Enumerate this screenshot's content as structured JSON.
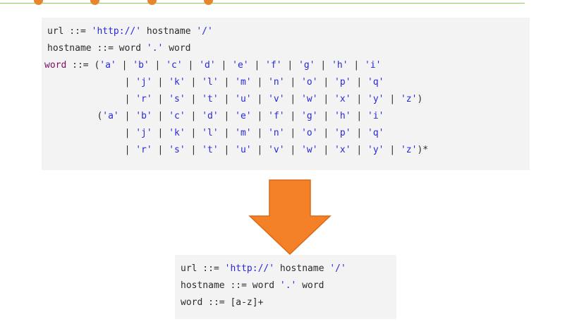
{
  "decor": {
    "line_color": "#8fd14f",
    "dot_color": "#e8862c",
    "dot_count": 4
  },
  "top_code": {
    "lines": [
      [
        {
          "t": "txt",
          "v": "url ::= "
        },
        {
          "t": "str",
          "v": "'http://'"
        },
        {
          "t": "txt",
          "v": " hostname "
        },
        {
          "t": "str",
          "v": "'/'"
        }
      ],
      [
        {
          "t": "txt",
          "v": "hostname ::= word "
        },
        {
          "t": "str",
          "v": "'.'"
        },
        {
          "t": "txt",
          "v": " word"
        }
      ],
      [
        {
          "t": "kw-def",
          "v": "word"
        },
        {
          "t": "txt",
          "v": " ::= ("
        },
        {
          "t": "str",
          "v": "'a'"
        },
        {
          "t": "txt",
          "v": " | "
        },
        {
          "t": "str",
          "v": "'b'"
        },
        {
          "t": "txt",
          "v": " | "
        },
        {
          "t": "str",
          "v": "'c'"
        },
        {
          "t": "txt",
          "v": " | "
        },
        {
          "t": "str",
          "v": "'d'"
        },
        {
          "t": "txt",
          "v": " | "
        },
        {
          "t": "str",
          "v": "'e'"
        },
        {
          "t": "txt",
          "v": " | "
        },
        {
          "t": "str",
          "v": "'f'"
        },
        {
          "t": "txt",
          "v": " | "
        },
        {
          "t": "str",
          "v": "'g'"
        },
        {
          "t": "txt",
          "v": " | "
        },
        {
          "t": "str",
          "v": "'h'"
        },
        {
          "t": "txt",
          "v": " | "
        },
        {
          "t": "str",
          "v": "'i'"
        }
      ],
      [
        {
          "t": "txt",
          "v": "              | "
        },
        {
          "t": "str",
          "v": "'j'"
        },
        {
          "t": "txt",
          "v": " | "
        },
        {
          "t": "str",
          "v": "'k'"
        },
        {
          "t": "txt",
          "v": " | "
        },
        {
          "t": "str",
          "v": "'l'"
        },
        {
          "t": "txt",
          "v": " | "
        },
        {
          "t": "str",
          "v": "'m'"
        },
        {
          "t": "txt",
          "v": " | "
        },
        {
          "t": "str",
          "v": "'n'"
        },
        {
          "t": "txt",
          "v": " | "
        },
        {
          "t": "str",
          "v": "'o'"
        },
        {
          "t": "txt",
          "v": " | "
        },
        {
          "t": "str",
          "v": "'p'"
        },
        {
          "t": "txt",
          "v": " | "
        },
        {
          "t": "str",
          "v": "'q'"
        }
      ],
      [
        {
          "t": "txt",
          "v": "              | "
        },
        {
          "t": "str",
          "v": "'r'"
        },
        {
          "t": "txt",
          "v": " | "
        },
        {
          "t": "str",
          "v": "'s'"
        },
        {
          "t": "txt",
          "v": " | "
        },
        {
          "t": "str",
          "v": "'t'"
        },
        {
          "t": "txt",
          "v": " | "
        },
        {
          "t": "str",
          "v": "'u'"
        },
        {
          "t": "txt",
          "v": " | "
        },
        {
          "t": "str",
          "v": "'v'"
        },
        {
          "t": "txt",
          "v": " | "
        },
        {
          "t": "str",
          "v": "'w'"
        },
        {
          "t": "txt",
          "v": " | "
        },
        {
          "t": "str",
          "v": "'x'"
        },
        {
          "t": "txt",
          "v": " | "
        },
        {
          "t": "str",
          "v": "'y'"
        },
        {
          "t": "txt",
          "v": " | "
        },
        {
          "t": "str",
          "v": "'z'"
        },
        {
          "t": "txt",
          "v": ")"
        }
      ],
      [
        {
          "t": "txt",
          "v": "         ("
        },
        {
          "t": "str",
          "v": "'a'"
        },
        {
          "t": "txt",
          "v": " | "
        },
        {
          "t": "str",
          "v": "'b'"
        },
        {
          "t": "txt",
          "v": " | "
        },
        {
          "t": "str",
          "v": "'c'"
        },
        {
          "t": "txt",
          "v": " | "
        },
        {
          "t": "str",
          "v": "'d'"
        },
        {
          "t": "txt",
          "v": " | "
        },
        {
          "t": "str",
          "v": "'e'"
        },
        {
          "t": "txt",
          "v": " | "
        },
        {
          "t": "str",
          "v": "'f'"
        },
        {
          "t": "txt",
          "v": " | "
        },
        {
          "t": "str",
          "v": "'g'"
        },
        {
          "t": "txt",
          "v": " | "
        },
        {
          "t": "str",
          "v": "'h'"
        },
        {
          "t": "txt",
          "v": " | "
        },
        {
          "t": "str",
          "v": "'i'"
        }
      ],
      [
        {
          "t": "txt",
          "v": "              | "
        },
        {
          "t": "str",
          "v": "'j'"
        },
        {
          "t": "txt",
          "v": " | "
        },
        {
          "t": "str",
          "v": "'k'"
        },
        {
          "t": "txt",
          "v": " | "
        },
        {
          "t": "str",
          "v": "'l'"
        },
        {
          "t": "txt",
          "v": " | "
        },
        {
          "t": "str",
          "v": "'m'"
        },
        {
          "t": "txt",
          "v": " | "
        },
        {
          "t": "str",
          "v": "'n'"
        },
        {
          "t": "txt",
          "v": " | "
        },
        {
          "t": "str",
          "v": "'o'"
        },
        {
          "t": "txt",
          "v": " | "
        },
        {
          "t": "str",
          "v": "'p'"
        },
        {
          "t": "txt",
          "v": " | "
        },
        {
          "t": "str",
          "v": "'q'"
        }
      ],
      [
        {
          "t": "txt",
          "v": "              | "
        },
        {
          "t": "str",
          "v": "'r'"
        },
        {
          "t": "txt",
          "v": " | "
        },
        {
          "t": "str",
          "v": "'s'"
        },
        {
          "t": "txt",
          "v": " | "
        },
        {
          "t": "str",
          "v": "'t'"
        },
        {
          "t": "txt",
          "v": " | "
        },
        {
          "t": "str",
          "v": "'u'"
        },
        {
          "t": "txt",
          "v": " | "
        },
        {
          "t": "str",
          "v": "'v'"
        },
        {
          "t": "txt",
          "v": " | "
        },
        {
          "t": "str",
          "v": "'w'"
        },
        {
          "t": "txt",
          "v": " | "
        },
        {
          "t": "str",
          "v": "'x'"
        },
        {
          "t": "txt",
          "v": " | "
        },
        {
          "t": "str",
          "v": "'y'"
        },
        {
          "t": "txt",
          "v": " | "
        },
        {
          "t": "str",
          "v": "'z'"
        },
        {
          "t": "txt",
          "v": ")*"
        }
      ]
    ]
  },
  "arrow": {
    "color": "#f48128",
    "stroke": "#d96a17",
    "icon": "down-arrow-icon"
  },
  "bottom_code": {
    "lines": [
      [
        {
          "t": "txt",
          "v": "url ::= "
        },
        {
          "t": "str",
          "v": "'http://'"
        },
        {
          "t": "txt",
          "v": " hostname "
        },
        {
          "t": "str",
          "v": "'/'"
        }
      ],
      [
        {
          "t": "txt",
          "v": "hostname ::= word "
        },
        {
          "t": "str",
          "v": "'.'"
        },
        {
          "t": "txt",
          "v": " word"
        }
      ],
      [
        {
          "t": "txt",
          "v": "word ::= [a-z]+"
        }
      ]
    ]
  }
}
